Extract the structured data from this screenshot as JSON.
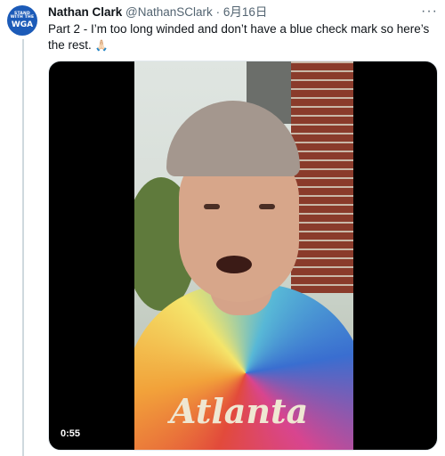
{
  "avatar": {
    "line1": "STAND",
    "line2": "WITH THE",
    "line3": "WGA"
  },
  "author": {
    "name": "Nathan Clark",
    "handle": "@NathanSClark",
    "separator": "·",
    "date": "6月16日"
  },
  "tweet": {
    "text": "Part 2 - I’m too long winded and don’t have a blue check mark so here’s the rest.",
    "emoji": "🙏🏻"
  },
  "video": {
    "duration": "0:55",
    "shirt_text": "Atlanta"
  },
  "icons": {
    "more": "more-options-icon"
  },
  "more_glyph": "···",
  "colors": {
    "avatar_bg": "#1c5bb8",
    "secondary_text": "#536471",
    "thread_line": "#cfd9de"
  }
}
